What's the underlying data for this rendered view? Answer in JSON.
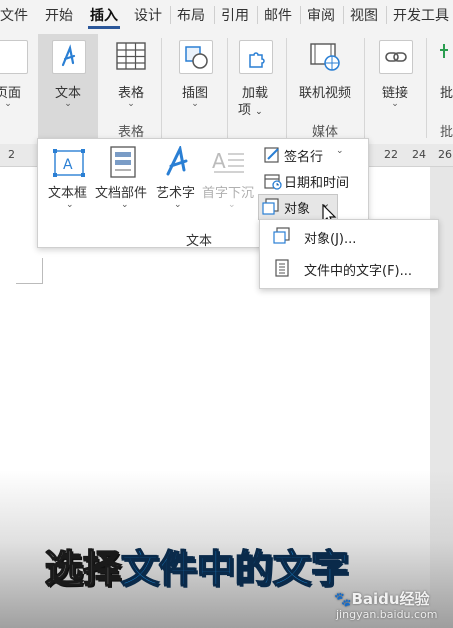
{
  "tabs": [
    "文件",
    "开始",
    "插入",
    "设计",
    "布局",
    "引用",
    "邮件",
    "审阅",
    "视图",
    "开发工具"
  ],
  "active_tab": "插入",
  "ribbon": {
    "page_label": "页面",
    "text_label": "文本",
    "table_label": "表格",
    "table_group": "表格",
    "illustration_label": "插图",
    "addins_label1": "加载",
    "addins_label2": "项",
    "online_video_label": "联机视频",
    "media_group": "媒体",
    "link_label": "链接",
    "comment_label": "批",
    "comment_group": "批"
  },
  "ruler_numbers": [
    "2",
    "22",
    "24",
    "26"
  ],
  "text_panel": {
    "textbox": "文本框",
    "quick_parts": "文档部件",
    "wordart": "艺术字",
    "dropcap": "首字下沉",
    "signature_line": "签名行",
    "date_time": "日期和时间",
    "object": "对象",
    "group_label": "文本"
  },
  "submenu": {
    "object_item": "对象(J)...",
    "text_from_file": "文件中的文字(F)..."
  },
  "caption": {
    "part1": "选择",
    "part2": "文件中的文字"
  },
  "watermark": {
    "brand": "Baidu经验",
    "url": "jingyan.baidu.com"
  },
  "colors": {
    "accent": "#2b579a",
    "caption_blue": "#1b8fe0",
    "wordart_blue": "#2a7fd4"
  }
}
